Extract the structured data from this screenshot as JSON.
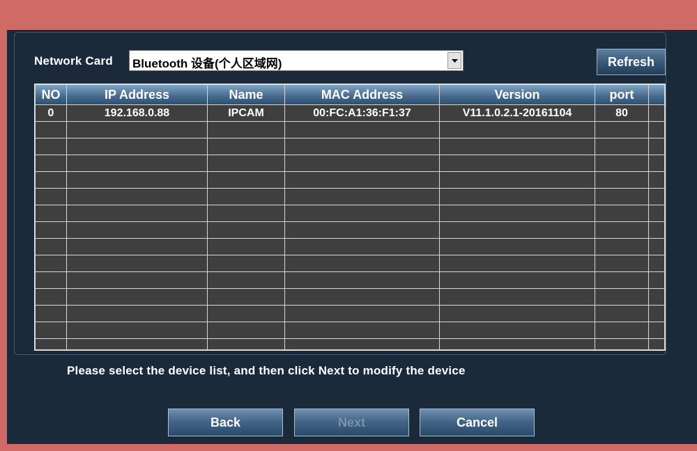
{
  "network_card": {
    "label": "Network Card",
    "selected": "Bluetooth 设备(个人区域网)"
  },
  "refresh_label": "Refresh",
  "table": {
    "headers": [
      "NO",
      "IP Address",
      "Name",
      "MAC Address",
      "Version",
      "port"
    ],
    "rows": [
      [
        "0",
        "192.168.0.88",
        "IPCAM",
        "00:FC:A1:36:F1:37",
        "V11.1.0.2.1-20161104",
        "80"
      ]
    ]
  },
  "instruction": "Please select the device list, and then click Next to modify the device",
  "buttons": {
    "back": "Back",
    "next": "Next",
    "cancel": "Cancel"
  }
}
